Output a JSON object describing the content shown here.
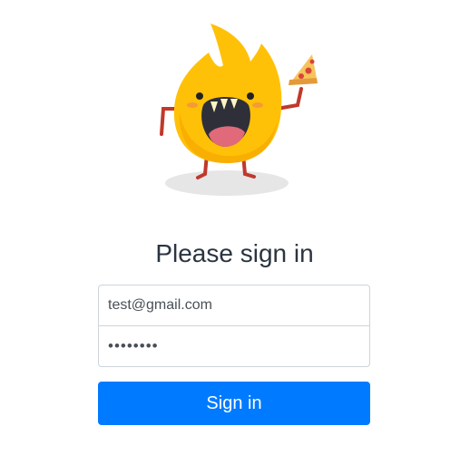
{
  "login": {
    "title": "Please sign in",
    "email_value": "test@gmail.com",
    "password_value": "password",
    "submit_label": "Sign in"
  },
  "icons": {
    "mascot": "flame-mascot-with-pizza-icon"
  },
  "colors": {
    "primary_button": "#007bff",
    "flame": "#ffc107",
    "title_text": "#2b3440"
  }
}
